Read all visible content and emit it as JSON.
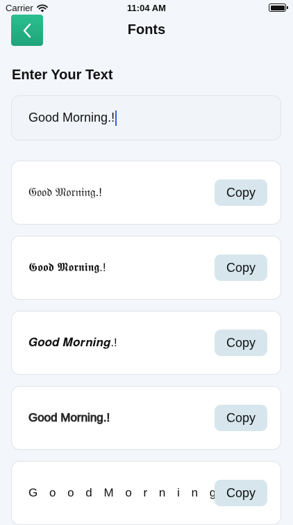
{
  "status_bar": {
    "carrier": "Carrier",
    "time": "11:04 AM"
  },
  "header": {
    "title": "Fonts",
    "back_icon": "chevron-left-icon"
  },
  "input_section": {
    "label": "Enter Your Text",
    "value": "Good Morning.!"
  },
  "font_samples": [
    {
      "text": "𝔊𝔬𝔬𝔡 𝔐𝔬𝔯𝔫𝔦𝔫𝔤.!",
      "copy_label": "Copy"
    },
    {
      "text": "𝕲𝖔𝖔𝖉 𝕸𝖔𝖗𝖓𝖎𝖓𝖌.!",
      "copy_label": "Copy"
    },
    {
      "text": "𝑮𝒐𝒐𝒅 𝑴𝒐𝒓𝒏𝒊𝒏𝒈.!",
      "copy_label": "Copy"
    },
    {
      "text": "Good Morning.!",
      "copy_label": "Copy"
    },
    {
      "text": "G o o d M o r n i n g . !",
      "copy_label": "Copy"
    }
  ],
  "colors": {
    "accent_green": "#25b385",
    "copy_button_bg": "#d6e6ec",
    "page_bg": "#f3f6fa"
  }
}
